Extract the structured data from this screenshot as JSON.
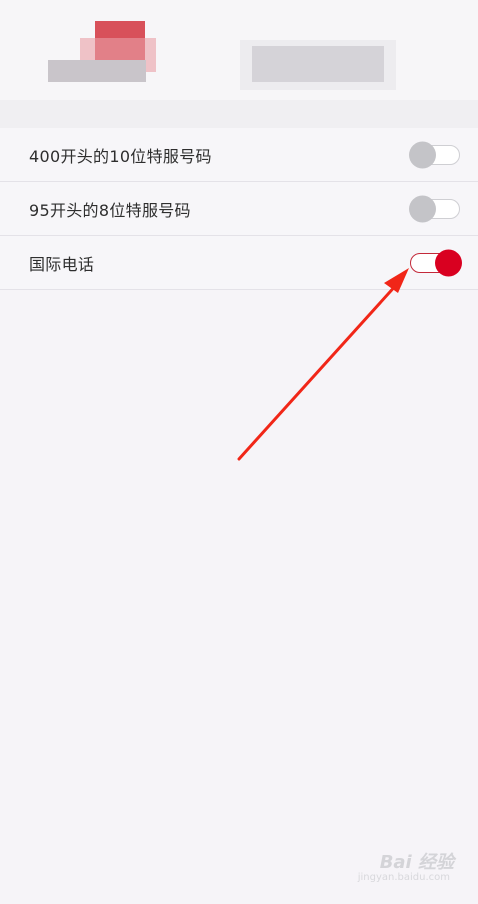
{
  "settings": [
    {
      "label": "400开头的10位特服号码",
      "enabled": false
    },
    {
      "label": "95开头的8位特服号码",
      "enabled": false
    },
    {
      "label": "国际电话",
      "enabled": true
    }
  ],
  "colors": {
    "accent": "#d90020",
    "arrow": "#f12618",
    "toggle_off_knob": "#c4c4c8"
  },
  "watermark": {
    "main": "Bai 经验",
    "sub": "jingyan.baidu.com"
  }
}
